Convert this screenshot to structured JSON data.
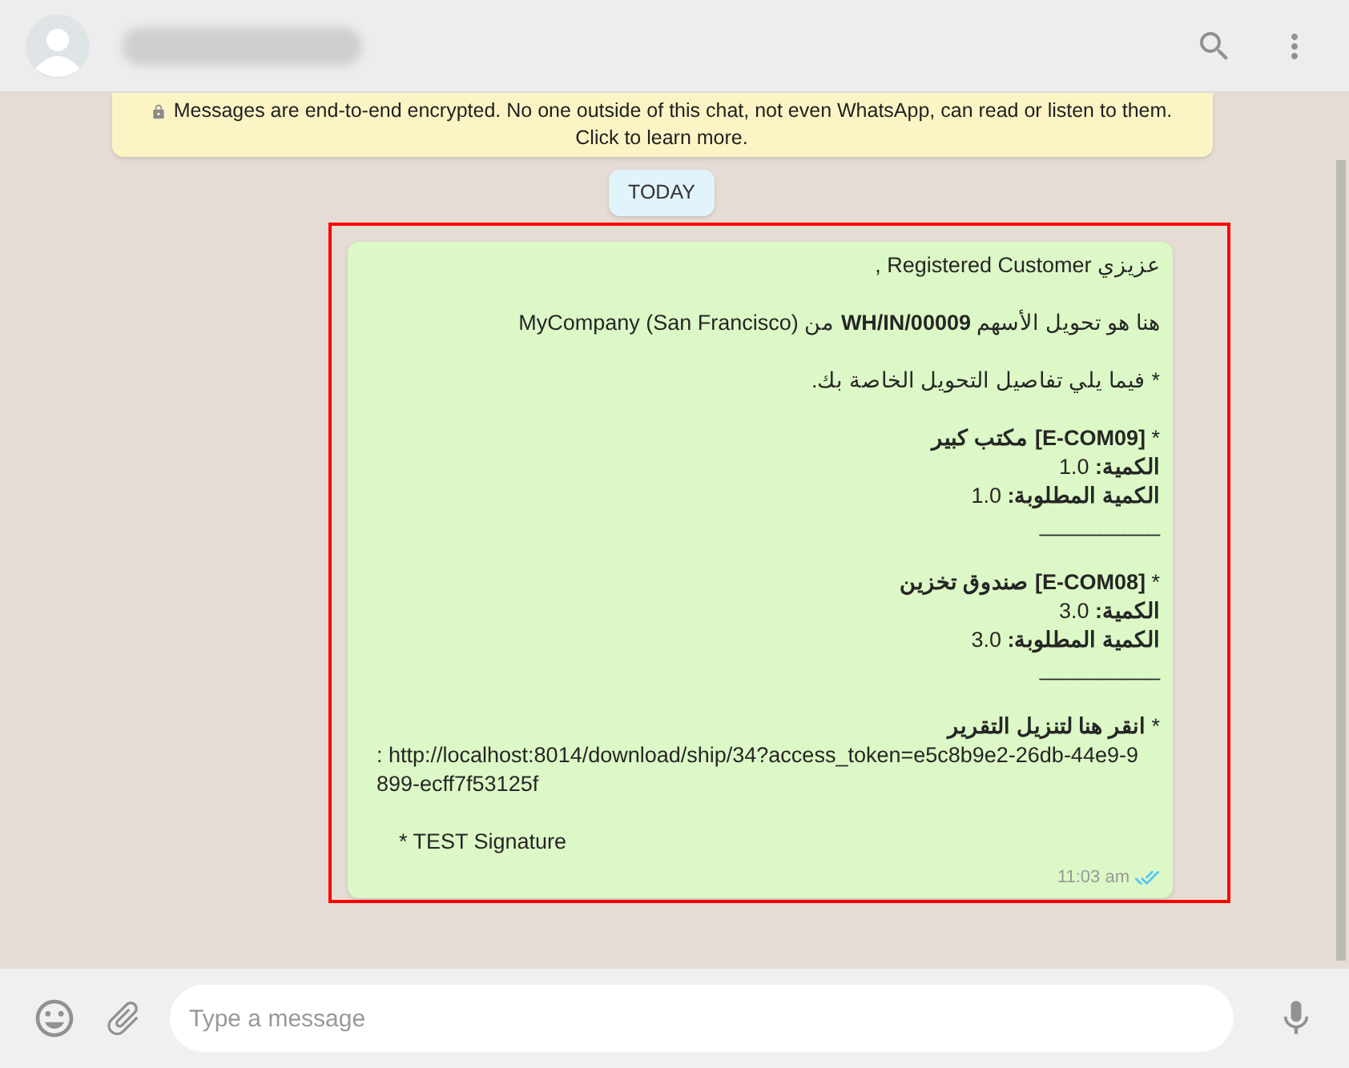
{
  "header": {
    "contact_name_blurred": true
  },
  "notice": {
    "text": "Messages are end-to-end encrypted. No one outside of this chat, not even WhatsApp, can read or listen to them.",
    "link": "Click to learn more."
  },
  "date_chip": "TODAY",
  "message": {
    "lines": [
      {
        "kind": "rtl",
        "text": "عزيزي Registered Customer ,"
      },
      {
        "kind": "spacer"
      },
      {
        "kind": "rtl",
        "text": "هنا هو تحويل الأسهم **WH/IN/00009** من MyCompany (San Francisco)"
      },
      {
        "kind": "spacer"
      },
      {
        "kind": "rtl",
        "text": "* فيما يلي تفاصيل التحويل الخاصة بك."
      },
      {
        "kind": "spacer"
      },
      {
        "kind": "rtl",
        "text": "* **[E-COM09] مكتب كبير**"
      },
      {
        "kind": "rtl",
        "text": "**الكمية:** 1.0"
      },
      {
        "kind": "rtl",
        "text": "**الكمية المطلوبة:** 1.0"
      },
      {
        "kind": "rtl",
        "text": "__________"
      },
      {
        "kind": "spacer"
      },
      {
        "kind": "rtl",
        "text": "* **[E-COM08] صندوق تخزين**"
      },
      {
        "kind": "rtl",
        "text": "**الكمية:** 3.0"
      },
      {
        "kind": "rtl",
        "text": "**الكمية المطلوبة:** 3.0"
      },
      {
        "kind": "rtl",
        "text": "__________"
      },
      {
        "kind": "spacer"
      },
      {
        "kind": "rtl",
        "text": "* **انقر هنا لتنزيل التقرير**"
      },
      {
        "kind": "url",
        "text": ": http://localhost:8014/download/ship/34?access_token=e5c8b9e2-26db-44e9-9899-ecff7f53125f"
      },
      {
        "kind": "spacer"
      },
      {
        "kind": "signature",
        "text": "* TEST Signature"
      }
    ],
    "time": "11:03 am",
    "read": true,
    "highlighted": true
  },
  "composer": {
    "placeholder": "Type a message"
  }
}
